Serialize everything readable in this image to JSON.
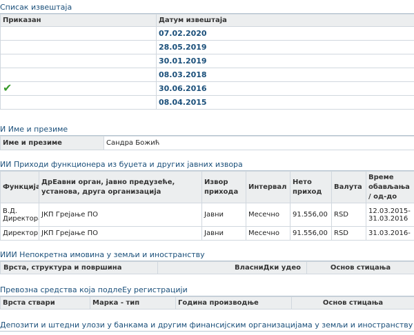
{
  "reports": {
    "title": "Списак извештаја",
    "headers": [
      "Приказан",
      "Датум извештаја"
    ],
    "rows": [
      {
        "shown": "",
        "date": "07.02.2020"
      },
      {
        "shown": "",
        "date": "28.05.2019"
      },
      {
        "shown": "",
        "date": "30.01.2019"
      },
      {
        "shown": "",
        "date": "08.03.2018"
      },
      {
        "shown": "✔",
        "date": "30.06.2016"
      },
      {
        "shown": "",
        "date": "08.04.2015"
      }
    ]
  },
  "section1": {
    "title": "И Име и презиме",
    "label": "Име и презиме",
    "value": "Сандра Божић"
  },
  "section2": {
    "title": "ИИ Приходи функционера из буџета и других јавних извора",
    "headers": [
      "Функција",
      "ДрЕавни орган, јавно предузеће, установа, друга организација",
      "Извор прихода",
      "Интервал",
      "Нето приход",
      "Валута",
      "Време обављања / од-до"
    ],
    "rows": [
      {
        "function": "В.Д. Директора",
        "org": "ЈКП Грејање ПО",
        "source": "Јавни",
        "interval": "Месечно",
        "net": "91.556,00",
        "currency": "RSD",
        "period": "12.03.2015-31.03.2016"
      },
      {
        "function": "Директор",
        "org": "ЈКП Грејање ПО",
        "source": "Јавни",
        "interval": "Месечно",
        "net": "91.556,00",
        "currency": "RSD",
        "period": "31.03.2016-"
      }
    ]
  },
  "section3": {
    "title": "ИИИ Непокретна имовина у земљи и иностранству",
    "headers": [
      "Врста, структура и површина",
      "ВласниДки удео",
      "Основ стицања"
    ]
  },
  "section4": {
    "title": "Превозна средства која подлеЕу регистрацији",
    "headers": [
      "Врста ствари",
      "Марка - тип",
      "Година производње",
      "Основ стицања"
    ]
  },
  "section5": {
    "title": "Депозити и штедни улози у банкама и другим финансијским организацијама у земљи и иностранству"
  },
  "colors": {
    "accent": "#1a4f7a",
    "header_bg": "#eceeef",
    "check": "#3a9b2d"
  },
  "icons": {
    "shown_marker": "checkmark-icon"
  }
}
